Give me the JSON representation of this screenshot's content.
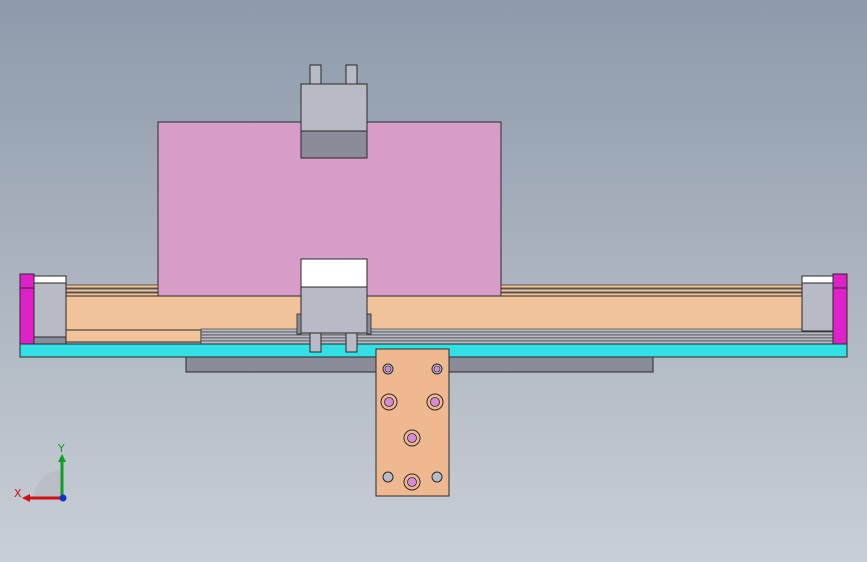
{
  "view": {
    "background_top": "#8e9aab",
    "background_bottom": "#c9cfd6"
  },
  "colors": {
    "plate_pink": "#d89cc8",
    "rail_tan": "#f0c39b",
    "base_cyan": "#33e0e6",
    "end_magenta": "#e020c8",
    "bracket_copper": "#f0b890",
    "block_grey": "#b8bac6",
    "block_grey_dark": "#8a8c9a",
    "block_white": "#ffffff",
    "slot_grey": "#9a9a9a",
    "hole_pink": "#d88ad8",
    "hole_grey": "#b8bcc8",
    "outline": "#2a2a2a"
  },
  "triad": {
    "x_label": "X",
    "y_label": "Y",
    "x_color": "#d01010",
    "y_color": "#10a020",
    "z_color": "#1030d0"
  }
}
